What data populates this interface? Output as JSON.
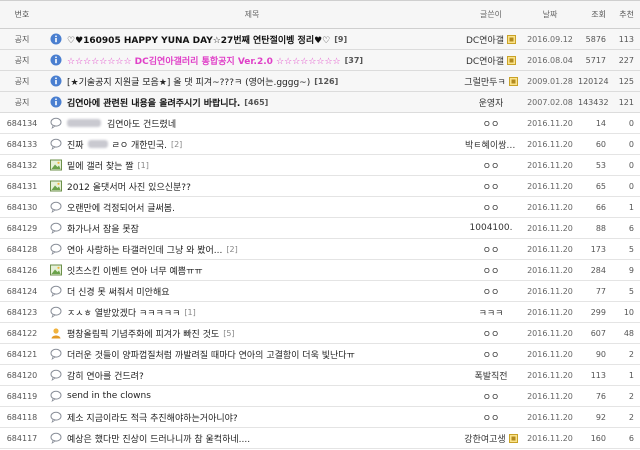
{
  "header": {
    "num": "번호",
    "title": "제목",
    "writer": "글쓴이",
    "date": "날짜",
    "views": "조회",
    "rec": "추천"
  },
  "notices": [
    {
      "num": "공지",
      "title": "♡♥160905 HAPPY YUNA DAY☆27번째 연탄절이벵 정리♥♡",
      "comments": "[9]",
      "style": "bold",
      "writer": "DC연아갤",
      "has_level": true,
      "date": "2016.09.12",
      "views": "5876",
      "rec": "113"
    },
    {
      "num": "공지",
      "title": "☆☆☆☆☆☆☆☆ DC김연아갤러리 통합공지 Ver.2.0 ☆☆☆☆☆☆☆☆",
      "comments": "[37]",
      "style": "pink",
      "writer": "DC연아갤",
      "has_level": true,
      "date": "2016.08.04",
      "views": "5717",
      "rec": "227"
    },
    {
      "num": "공지",
      "title": "[★기술공지 지원글 모음★] 올 댓 피겨~???ㅋ (영어는.gggg~)",
      "comments": "[126]",
      "style": "normal",
      "writer": "그럴만두ㅋ",
      "has_level": true,
      "date": "2009.01.28",
      "views": "120124",
      "rec": "125"
    },
    {
      "num": "공지",
      "title": "김연아에 관련된 내용을 올려주시기 바랍니다.",
      "comments": "[465]",
      "style": "bold",
      "writer": "운영자",
      "has_level": false,
      "date": "2007.02.08",
      "views": "143432",
      "rec": "121"
    }
  ],
  "posts": [
    {
      "num": "684134",
      "icon": "speech-bubble",
      "title": "김연아도 건드렸네",
      "blur": "before",
      "comments": "",
      "writer": "ㅇㅇ",
      "has_level": false,
      "date": "2016.11.20",
      "views": "14",
      "rec": "0"
    },
    {
      "num": "684133",
      "icon": "speech-bubble",
      "title_a": "진짜",
      "title_b": "ㄹㅇ 개한민국.",
      "blur": "middle",
      "comments": "[2]",
      "writer": "박ㅌ혜이쌍년아",
      "has_level": false,
      "date": "2016.11.20",
      "views": "60",
      "rec": "0"
    },
    {
      "num": "684132",
      "icon": "picture",
      "title": "밑에 갤러 찾는 짤",
      "comments": "[1]",
      "writer": "ㅇㅇ",
      "has_level": false,
      "date": "2016.11.20",
      "views": "53",
      "rec": "0"
    },
    {
      "num": "684131",
      "icon": "picture",
      "title": "2012 올댓서머 사진 있으신분??",
      "comments": "",
      "writer": "ㅇㅇ",
      "has_level": false,
      "date": "2016.11.20",
      "views": "65",
      "rec": "0"
    },
    {
      "num": "684130",
      "icon": "speech-bubble",
      "title": "오랜만에 걱정되어서 글써봄.",
      "comments": "",
      "writer": "ㅇㅇ",
      "has_level": false,
      "date": "2016.11.20",
      "views": "66",
      "rec": "1"
    },
    {
      "num": "684129",
      "icon": "speech-bubble",
      "title": "화가나서 잠을 못잠",
      "comments": "",
      "writer": "1004100.",
      "has_level": false,
      "date": "2016.11.20",
      "views": "88",
      "rec": "6"
    },
    {
      "num": "684128",
      "icon": "speech-bubble",
      "title": "연아 사랑하는 타갤러인데 그냥 와 봤어...",
      "comments": "[2]",
      "writer": "ㅇㅇ",
      "has_level": false,
      "date": "2016.11.20",
      "views": "173",
      "rec": "5"
    },
    {
      "num": "684126",
      "icon": "picture",
      "title": "잇츠스킨 이벤트 연아 너무 예쁨ㅠㅠ",
      "comments": "",
      "writer": "ㅇㅇ",
      "has_level": false,
      "date": "2016.11.20",
      "views": "284",
      "rec": "9"
    },
    {
      "num": "684124",
      "icon": "speech-bubble",
      "title": "더 신경 못 써줘서 미안해요",
      "comments": "",
      "writer": "ㅇㅇ",
      "has_level": false,
      "date": "2016.11.20",
      "views": "77",
      "rec": "5"
    },
    {
      "num": "684123",
      "icon": "speech-bubble",
      "title": "ㅈㅅㅎ 열받았겠다 ㅋㅋㅋㅋㅋ",
      "comments": "[1]",
      "writer": "ㅋㅋㅋ",
      "has_level": false,
      "date": "2016.11.20",
      "views": "299",
      "rec": "10"
    },
    {
      "num": "684122",
      "icon": "person",
      "title": "평창올림픽 기념주화에 피겨가 빠진 것도",
      "comments": "[5]",
      "writer": "ㅇㅇ",
      "has_level": false,
      "date": "2016.11.20",
      "views": "607",
      "rec": "48"
    },
    {
      "num": "684121",
      "icon": "speech-bubble",
      "title": "더러운 것들이 양파껍질처럼 까발려질 때마다 연아의 고결함이 더욱 빛난다ㅠ",
      "comments": "",
      "writer": "ㅇㅇ",
      "has_level": false,
      "date": "2016.11.20",
      "views": "90",
      "rec": "2"
    },
    {
      "num": "684120",
      "icon": "speech-bubble",
      "title": "감히 연아를 건드려?",
      "comments": "",
      "writer": "폭발직전",
      "has_level": false,
      "date": "2016.11.20",
      "views": "113",
      "rec": "1"
    },
    {
      "num": "684119",
      "icon": "speech-bubble",
      "title": "send in the clowns",
      "comments": "",
      "writer": "ㅇㅇ",
      "has_level": false,
      "date": "2016.11.20",
      "views": "76",
      "rec": "2"
    },
    {
      "num": "684118",
      "icon": "speech-bubble",
      "title": "제소 지금이라도 적극 추진해야하는거아니야?",
      "comments": "",
      "writer": "ㅇㅇ",
      "has_level": false,
      "date": "2016.11.20",
      "views": "92",
      "rec": "2"
    },
    {
      "num": "684117",
      "icon": "speech-bubble",
      "title": "예상은 했다만 진상이 드러나니까 참 울컥하네....",
      "comments": "",
      "writer": "강한여고생",
      "has_level": true,
      "date": "2016.11.20",
      "views": "160",
      "rec": "6"
    }
  ]
}
